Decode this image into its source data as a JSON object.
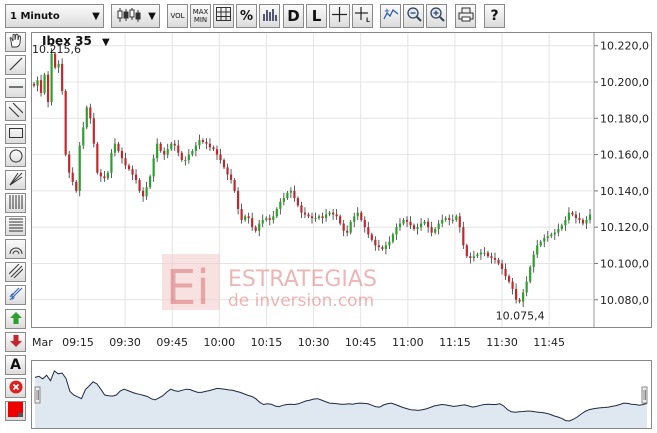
{
  "toolbar": {
    "interval": "1 Minuto",
    "vol_label": "VOL",
    "maxmin_label_1": "MAX",
    "maxmin_label_2": "MIN",
    "percent_label": "%",
    "d_label": "D",
    "l_label": "L",
    "help_label": "?"
  },
  "sidebar": {
    "text_tool_label": "A"
  },
  "watermark": {
    "brand_line1": "ESTRATEGIAS",
    "brand_line2": "de inversion.com",
    "logo_text": "Ei"
  },
  "colors": {
    "up": "#2ca02c",
    "down": "#c1272d",
    "grid": "#e4e4e4",
    "watermark": "#e07a7a"
  },
  "chart_data": {
    "type": "candlestick",
    "title": "Ibex 35",
    "max_label": "10.215,6",
    "min_label": "10.075,4",
    "x_tick_labels": [
      "Mar",
      "09:15",
      "09:30",
      "09:45",
      "10:00",
      "10:15",
      "10:30",
      "10:45",
      "11:00",
      "11:15",
      "11:30",
      "11:45"
    ],
    "y_tick_labels": [
      "10.080,0",
      "10.100,0",
      "10.120,0",
      "10.140,0",
      "10.160,0",
      "10.180,0",
      "10.200,0",
      "10.220,0"
    ],
    "y_ticks": [
      10080,
      10100,
      10120,
      10140,
      10160,
      10180,
      10200,
      10220
    ],
    "ylim": [
      10065,
      10227
    ],
    "x_start": "09:01",
    "x_end": "11:58",
    "series": [
      {
        "values": [
          10198.0,
          10201.0,
          10194.0,
          10204.0,
          10189.0,
          10215.6,
          10208.0,
          10210.0,
          10195.0,
          10160.0,
          10150.0,
          10145.0,
          10140.0,
          10165.0,
          10175.0,
          10186.0,
          10180.0,
          10166.0,
          10150.0,
          10148.0,
          10147.0,
          10150.0,
          10161.0,
          10166.0,
          10162.0,
          10158.0,
          10154.0,
          10152.0,
          10149.0,
          10146.0,
          10140.0,
          10137.0,
          10142.0,
          10148.0,
          10158.0,
          10166.0,
          10162.0,
          10160.0,
          10163.0,
          10166.0,
          10165.0,
          10161.0,
          10157.0,
          10157.0,
          10160.0,
          10162.0,
          10165.0,
          10168.0,
          10167.0,
          10166.0,
          10164.0,
          10163.0,
          10160.0,
          10157.0,
          10153.0,
          10149.0,
          10146.0,
          10140.0,
          10130.0,
          10124.0,
          10126.0,
          10125.0,
          10120.0,
          10118.0,
          10122.0,
          10124.0,
          10125.0,
          10124.0,
          10126.0,
          10130.0,
          10134.0,
          10136.0,
          10139.0,
          10140.0,
          10136.0,
          10132.0,
          10128.0,
          10127.0,
          10126.0,
          10125.0,
          10125.0,
          10126.0,
          10125.0,
          10127.0,
          10128.0,
          10127.0,
          10126.0,
          10122.0,
          10118.0,
          10117.0,
          10123.0,
          10126.0,
          10128.0,
          10124.0,
          10120.0,
          10116.0,
          10113.0,
          10110.0,
          10109.0,
          10108.0,
          10110.0,
          10112.0,
          10116.0,
          10120.0,
          10122.0,
          10124.0,
          10123.0,
          10121.0,
          10119.0,
          10120.0,
          10122.0,
          10123.0,
          10120.0,
          10117.0,
          10119.0,
          10122.0,
          10124.0,
          10125.0,
          10124.0,
          10124.0,
          10126.0,
          10120.0,
          10110.0,
          10104.0,
          10103.0,
          10104.0,
          10105.0,
          10106.0,
          10106.0,
          10104.0,
          10103.0,
          10102.0,
          10100.0,
          10097.0,
          10093.0,
          10090.0,
          10086.0,
          10080.0,
          10079.0,
          10084.0,
          10090.0,
          10098.0,
          10105.0,
          10110.0,
          10112.0,
          10114.0,
          10115.0,
          10116.0,
          10117.0,
          10119.0,
          10121.0,
          10124.0,
          10128.0,
          10127.0,
          10125.0,
          10124.0,
          10122.0,
          10124.0,
          10127.0
        ]
      }
    ]
  }
}
